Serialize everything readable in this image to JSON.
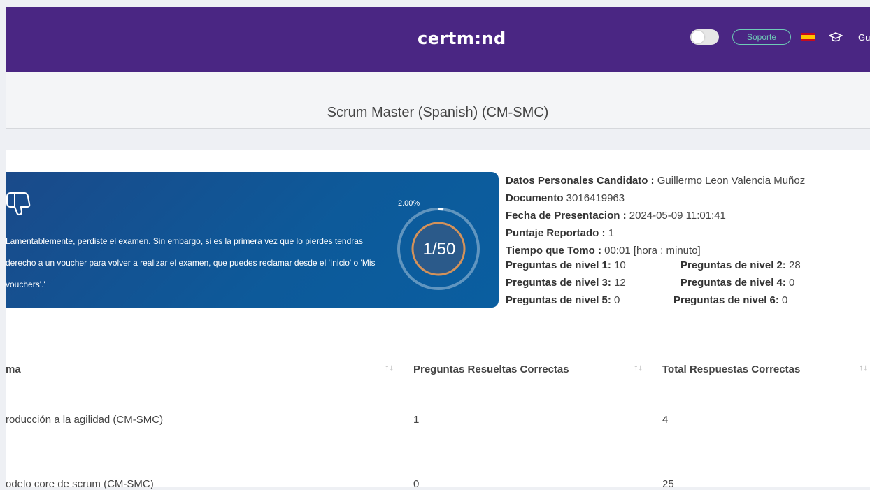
{
  "header": {
    "logo": "certm:nd",
    "support_label": "Soporte",
    "user_label": "Gui",
    "icons": [
      "toggle-switch",
      "spain-flag-icon",
      "graduation-cap-icon"
    ],
    "colors": {
      "bar": "#4a2683",
      "support": "#6ecbb7"
    }
  },
  "page": {
    "title": "Scrum Master (Spanish) (CM-SMC)"
  },
  "result": {
    "icon": "thumbs-down-icon",
    "message_lines": [
      "Lamentablemente, perdiste el examen. Sin embargo, si es la primera vez que lo pierdes tendras",
      "derecho a un voucher para volver a realizar el examen, que puedes reclamar desde el 'Inicio' o 'Mis",
      "vouchers'.'"
    ],
    "percent_label": "2.00%",
    "progress_fraction": 0.02,
    "score": "1/50"
  },
  "candidate": {
    "name_label": "Datos Personales Candidato :",
    "name_value": " Guillermo Leon Valencia Muñoz",
    "doc_label": "Documento",
    "doc_value": " 3016419963",
    "date_label": "Fecha de Presentacion :",
    "date_value": " 2024-05-09 11:01:41",
    "score_label": "Puntaje Reportado :",
    "score_value": " 1",
    "time_label": "Tiempo que Tomo :",
    "time_value": " 00:01 [hora : minuto]",
    "levels": [
      {
        "label": "Preguntas de nivel 1:",
        "value": " 10"
      },
      {
        "label": "Preguntas de nivel 2:",
        "value": " 28"
      },
      {
        "label": "Preguntas de nivel 3:",
        "value": " 12"
      },
      {
        "label": "Preguntas de nivel 4:",
        "value": " 0"
      },
      {
        "label": "Preguntas de nivel 5:",
        "value": " 0"
      },
      {
        "label": "Preguntas de nivel 6:",
        "value": " 0"
      }
    ]
  },
  "table": {
    "columns": [
      "ma",
      "Preguntas Resueltas Correctas",
      "Total Respuestas Correctas"
    ],
    "sort_glyph": "↑↓",
    "rows": [
      [
        "roducción a la agilidad (CM-SMC)",
        "1",
        "4"
      ],
      [
        "odelo core de scrum (CM-SMC)",
        "0",
        "25"
      ]
    ]
  }
}
